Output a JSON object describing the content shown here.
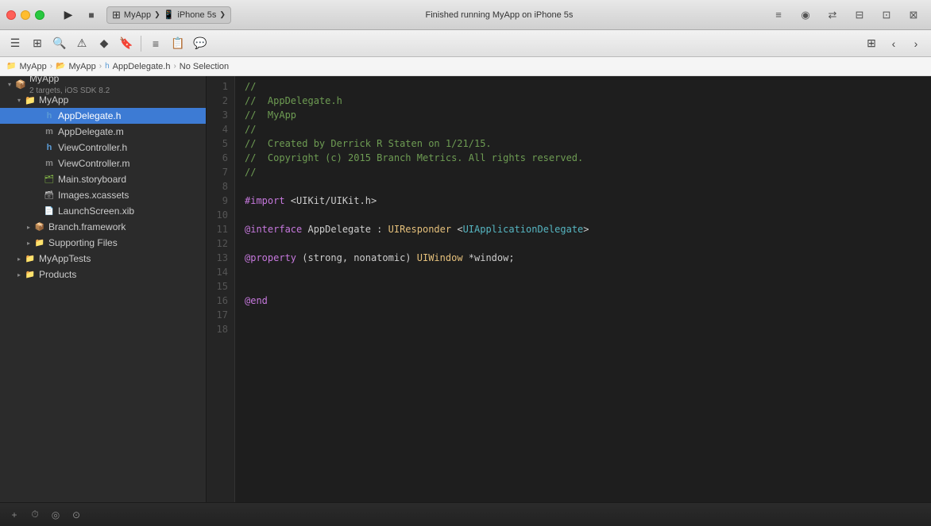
{
  "titlebar": {
    "app_name": "MyApp",
    "device": "iPhone 5s",
    "status": "Finished running MyApp on iPhone 5s",
    "run_icon": "▶",
    "stop_icon": "■",
    "scheme_icon": "⊞"
  },
  "breadcrumb": {
    "items": [
      "MyApp",
      "MyApp",
      "AppDelegate.h",
      "No Selection"
    ]
  },
  "sidebar": {
    "project": {
      "name": "MyApp",
      "subtitle": "2 targets, iOS SDK 8.2"
    },
    "items": [
      {
        "id": "myapp-group",
        "name": "MyApp",
        "type": "group",
        "indent": 1,
        "disclosure": "open"
      },
      {
        "id": "appdelegate-h",
        "name": "AppDelegate.h",
        "type": "h-file",
        "indent": 3,
        "disclosure": "empty",
        "selected": true
      },
      {
        "id": "appdelegate-m",
        "name": "AppDelegate.m",
        "type": "m-file",
        "indent": 3,
        "disclosure": "empty"
      },
      {
        "id": "viewcontroller-h",
        "name": "ViewController.h",
        "type": "h-file",
        "indent": 3,
        "disclosure": "empty"
      },
      {
        "id": "viewcontroller-m",
        "name": "ViewController.m",
        "type": "m-file",
        "indent": 3,
        "disclosure": "empty"
      },
      {
        "id": "main-storyboard",
        "name": "Main.storyboard",
        "type": "storyboard",
        "indent": 3,
        "disclosure": "empty"
      },
      {
        "id": "images-xcassets",
        "name": "Images.xcassets",
        "type": "xcassets",
        "indent": 3,
        "disclosure": "empty"
      },
      {
        "id": "launchscreen-xib",
        "name": "LaunchScreen.xib",
        "type": "xib",
        "indent": 3,
        "disclosure": "empty"
      },
      {
        "id": "branch-framework",
        "name": "Branch.framework",
        "type": "framework",
        "indent": 2,
        "disclosure": "closed"
      },
      {
        "id": "supporting-files",
        "name": "Supporting Files",
        "type": "supporting",
        "indent": 2,
        "disclosure": "closed"
      },
      {
        "id": "myapptests",
        "name": "MyAppTests",
        "type": "tests",
        "indent": 1,
        "disclosure": "closed"
      },
      {
        "id": "products",
        "name": "Products",
        "type": "products",
        "indent": 1,
        "disclosure": "closed"
      }
    ]
  },
  "editor": {
    "filename": "AppDelegate.h",
    "lines": [
      {
        "num": 1,
        "content": "//",
        "tokens": [
          {
            "text": "//",
            "class": "code-comment"
          }
        ]
      },
      {
        "num": 2,
        "content": "//  AppDelegate.h",
        "tokens": [
          {
            "text": "//  AppDelegate.h",
            "class": "code-comment"
          }
        ]
      },
      {
        "num": 3,
        "content": "//  MyApp",
        "tokens": [
          {
            "text": "//  MyApp",
            "class": "code-comment"
          }
        ]
      },
      {
        "num": 4,
        "content": "//",
        "tokens": [
          {
            "text": "//",
            "class": "code-comment"
          }
        ]
      },
      {
        "num": 5,
        "content": "//  Created by Derrick R Staten on 1/21/15.",
        "tokens": [
          {
            "text": "//  Created by Derrick R Staten on 1/21/15.",
            "class": "code-comment"
          }
        ]
      },
      {
        "num": 6,
        "content": "//  Copyright (c) 2015 Branch Metrics. All rights reserved.",
        "tokens": [
          {
            "text": "//  Copyright (c) 2015 Branch Metrics. All rights reserved.",
            "class": "code-comment"
          }
        ]
      },
      {
        "num": 7,
        "content": "//",
        "tokens": [
          {
            "text": "//",
            "class": "code-comment"
          }
        ]
      },
      {
        "num": 8,
        "content": "",
        "tokens": []
      },
      {
        "num": 9,
        "content": "#import <UIKit/UIKit.h>",
        "tokens": [
          {
            "text": "#import",
            "class": "code-keyword"
          },
          {
            "text": " <UIKit/UIKit.h>",
            "class": ""
          }
        ]
      },
      {
        "num": 10,
        "content": "",
        "tokens": []
      },
      {
        "num": 11,
        "content": "@interface AppDelegate : UIResponder <UIApplicationDelegate>",
        "tokens": [
          {
            "text": "@interface",
            "class": "code-keyword"
          },
          {
            "text": " AppDelegate : ",
            "class": ""
          },
          {
            "text": "UIResponder",
            "class": "code-type"
          },
          {
            "text": " <",
            "class": ""
          },
          {
            "text": "UIApplicationDelegate",
            "class": "code-protocol"
          },
          {
            "text": ">",
            "class": ""
          }
        ]
      },
      {
        "num": 12,
        "content": "",
        "tokens": []
      },
      {
        "num": 13,
        "content": "@property (strong, nonatomic) UIWindow *window;",
        "tokens": [
          {
            "text": "@property",
            "class": "code-keyword"
          },
          {
            "text": " (strong, nonatomic) ",
            "class": ""
          },
          {
            "text": "UIWindow",
            "class": "code-type"
          },
          {
            "text": " *window;",
            "class": ""
          }
        ]
      },
      {
        "num": 14,
        "content": "",
        "tokens": []
      },
      {
        "num": 15,
        "content": "",
        "tokens": []
      },
      {
        "num": 16,
        "content": "@end",
        "tokens": [
          {
            "text": "@end",
            "class": "code-keyword"
          }
        ]
      },
      {
        "num": 17,
        "content": "",
        "tokens": []
      },
      {
        "num": 18,
        "content": "",
        "tokens": []
      }
    ]
  },
  "toolbar": {
    "view_grid_icon": "⊞",
    "back_icon": "‹",
    "forward_icon": "›"
  }
}
